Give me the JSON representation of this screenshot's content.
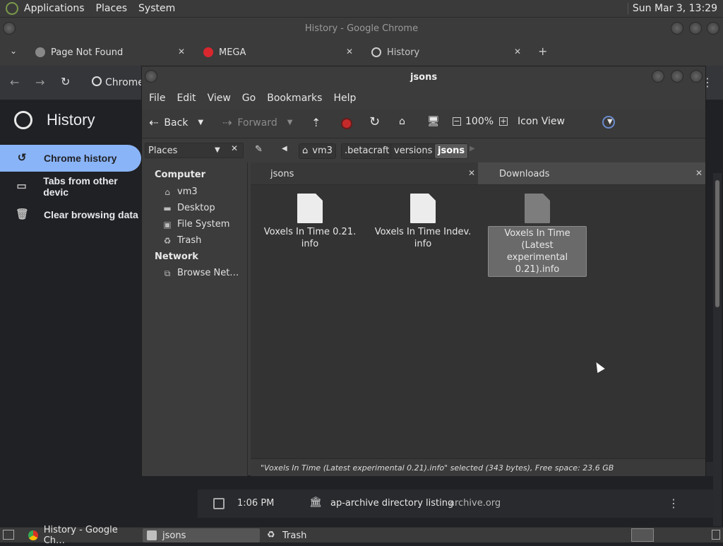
{
  "top_panel": {
    "menus": [
      "Applications",
      "Places",
      "System"
    ],
    "clock": "Sun Mar  3, 13:29"
  },
  "chrome": {
    "window_title": "History - Google Chrome",
    "tabs": [
      {
        "label": "Page Not Found"
      },
      {
        "label": "MEGA"
      },
      {
        "label": "History"
      }
    ],
    "omnibox_label": "Chrome",
    "page_title": "History",
    "sidebar": [
      {
        "label": "Chrome history",
        "icon": "history-icon"
      },
      {
        "label": "Tabs from other devic",
        "icon": "devices-icon"
      },
      {
        "label": "Clear browsing data",
        "icon": "trash-icon"
      }
    ],
    "history_row": {
      "time": "1:06 PM",
      "title": "ap-archive directory listing",
      "domain": "archive.org"
    }
  },
  "nautilus": {
    "window_title": "jsons",
    "menubar": [
      "File",
      "Edit",
      "View",
      "Go",
      "Bookmarks",
      "Help"
    ],
    "toolbar": {
      "back": "Back",
      "forward": "Forward",
      "zoom": "100%",
      "view_mode": "Icon View"
    },
    "places_label": "Places",
    "breadcrumbs": [
      "vm3",
      ".betacraft",
      "versions",
      "jsons"
    ],
    "places": {
      "computer_heading": "Computer",
      "computer_items": [
        "vm3",
        "Desktop",
        "File System",
        "Trash"
      ],
      "network_heading": "Network",
      "network_items": [
        "Browse Net…"
      ]
    },
    "panes": {
      "left_tab": "jsons",
      "right_tab": "Downloads"
    },
    "files": [
      {
        "name": "Voxels In Time 0.21.\ninfo",
        "selected": false
      },
      {
        "name": "Voxels In Time Indev.\ninfo",
        "selected": false
      },
      {
        "name": "Voxels In Time (Latest\nexperimental\n0.21).info",
        "selected": true
      }
    ],
    "status": "\"Voxels In Time (Latest experimental 0.21).info\" selected (343 bytes), Free space: 23.6 GB"
  },
  "taskbar": [
    {
      "label": "History - Google Ch…"
    },
    {
      "label": "jsons"
    },
    {
      "label": "Trash"
    }
  ]
}
